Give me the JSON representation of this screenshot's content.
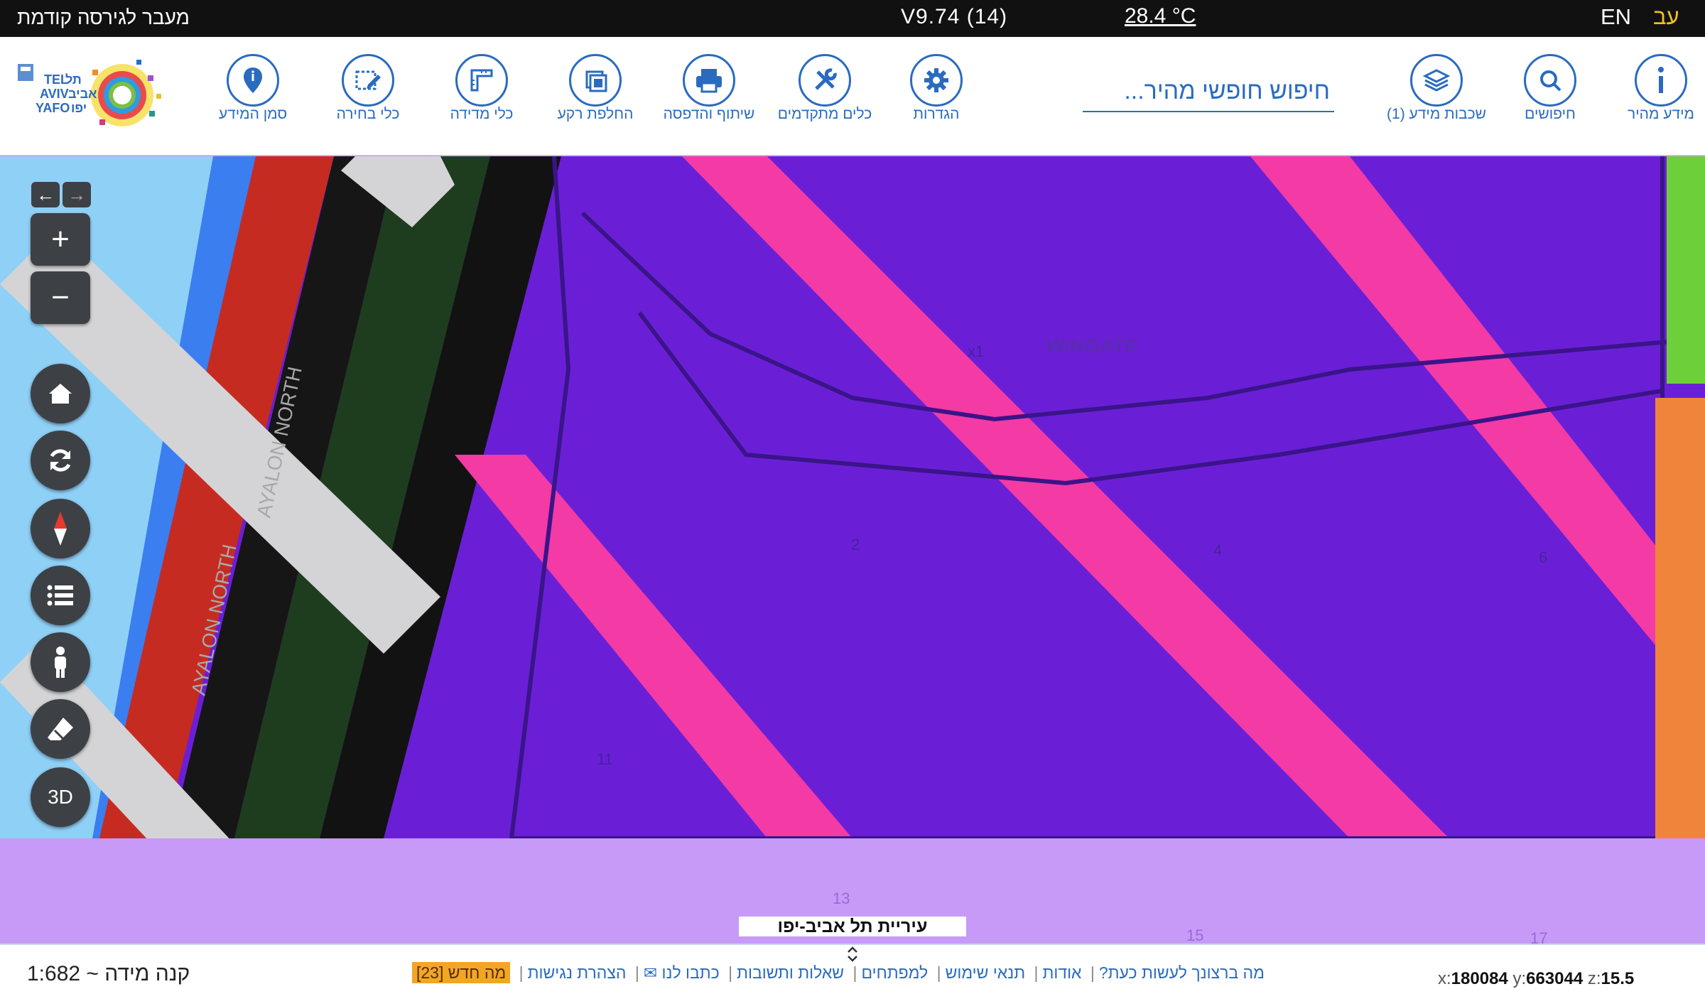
{
  "topbar": {
    "prev_version_link": "מעבר לגירסה קודמת",
    "version": "V9.74 (14)",
    "temperature": "28.4 °C",
    "lang_en": "EN",
    "lang_he": "עב"
  },
  "toolbar": {
    "items": [
      {
        "label": "מידע מהיר",
        "icon": "info-icon"
      },
      {
        "label": "חיפושים",
        "icon": "search-icon"
      },
      {
        "label": "שכבות מידע (1)",
        "icon": "layers-icon"
      },
      {
        "label": "הגדרות",
        "icon": "gear-icon"
      },
      {
        "label": "כלים מתקדמים",
        "icon": "tools-icon"
      },
      {
        "label": "שיתוף והדפסה",
        "icon": "printer-icon"
      },
      {
        "label": "החלפת רקע",
        "icon": "basemap-icon"
      },
      {
        "label": "כלי מדידה",
        "icon": "ruler-icon"
      },
      {
        "label": "כלי בחירה",
        "icon": "select-icon"
      },
      {
        "label": "סמן המידע",
        "icon": "pin-icon"
      }
    ],
    "search_placeholder": "חיפוש חופשי מהיר...",
    "logo_text_en_1": "TEL",
    "logo_text_en_2": "AVIV",
    "logo_text_en_3": "YAFO",
    "logo_text_he_1": "תל",
    "logo_text_he_2": "אביב",
    "logo_text_he_3": "יפו"
  },
  "map": {
    "street_labels": [
      "AYALON NORTH",
      "AYALON NORTH",
      "WINGATE"
    ],
    "parcel_numbers": [
      "2",
      "4",
      "6",
      "11",
      "13",
      "15",
      "17",
      "x1"
    ],
    "controls": {
      "prev_extent": "←",
      "next_extent": "→",
      "zoom_in": "+",
      "zoom_out": "−",
      "three_d": "3D"
    },
    "city_label": "עיריית תל אביב-יפו",
    "colors": {
      "purple": "#6a1fd6",
      "pink": "#f33aa5",
      "green": "#1e3d1e",
      "red": "#c62b22",
      "grey": "#d4d4d6",
      "sky": "#8fd0f7",
      "lilac": "#c79af7",
      "orange": "#f0843a",
      "lime": "#6dd03a"
    }
  },
  "bottombar": {
    "scale": "קנה מידה ~ 1:682",
    "links": [
      "מה ברצונך לעשות כעת?",
      "אודות",
      "תנאי שימוש",
      "למפתחים",
      "שאלות ותשובות",
      "כתבו לנו ✉",
      "הצהרת נגישות"
    ],
    "whats_new": "מה חדש [23]",
    "coords": {
      "x_label": "x:",
      "x": "180084",
      "y_label": "y:",
      "y": "663044",
      "z_label": "z:",
      "z": "15.5"
    }
  }
}
